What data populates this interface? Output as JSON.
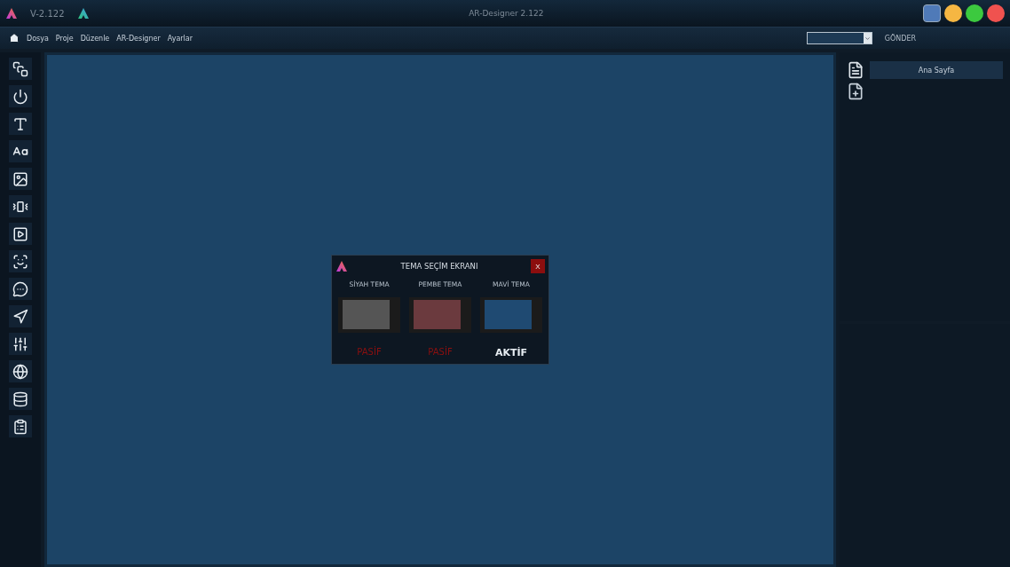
{
  "title_bar": {
    "version": "V-2.122",
    "title": "AR-Designer 2.122"
  },
  "window_buttons": [
    {
      "color": "#4f7ab8",
      "kind": "square"
    },
    {
      "color": "#f5b642",
      "kind": "round"
    },
    {
      "color": "#3cc93f",
      "kind": "round"
    },
    {
      "color": "#f0524f",
      "kind": "round"
    }
  ],
  "menu": [
    "Dosya",
    "Proje",
    "Düzenle",
    "AR-Designer",
    "Ayarlar"
  ],
  "send_button": "GÖNDER",
  "tools": [
    {
      "kind": "layers"
    },
    {
      "kind": "power"
    },
    {
      "kind": "text-height"
    },
    {
      "kind": "text-size"
    },
    {
      "kind": "image"
    },
    {
      "kind": "vibrate"
    },
    {
      "kind": "video"
    },
    {
      "kind": "scan"
    },
    {
      "kind": "chat"
    },
    {
      "kind": "navigate"
    },
    {
      "kind": "sliders"
    },
    {
      "kind": "globe"
    },
    {
      "kind": "database"
    },
    {
      "kind": "clipboard"
    }
  ],
  "pages": [
    {
      "label": "Ana Sayfa",
      "kind": "page"
    },
    {
      "kind": "add-page"
    }
  ],
  "dialog": {
    "title": "TEMA SEÇİM EKRANI",
    "close": "X",
    "themes": [
      {
        "name": "SİYAH TEMA",
        "color": "#555555",
        "status": "PASİF",
        "selected": false
      },
      {
        "name": "PEMBE TEMA",
        "color": "#6b3a3e",
        "status": "PASİF",
        "selected": false
      },
      {
        "name": "MAVİ TEMA",
        "color": "#1f4a72",
        "status": "AKTİF",
        "selected": true
      }
    ]
  }
}
